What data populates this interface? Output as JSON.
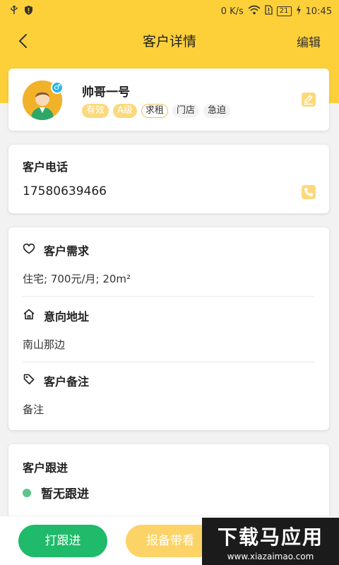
{
  "status_bar": {
    "network_speed": "0 K/s",
    "battery": "21",
    "time": "10:45"
  },
  "nav": {
    "title": "客户详情",
    "edit_label": "编辑",
    "back_icon": "chevron-left-icon"
  },
  "profile": {
    "name": "帅哥一号",
    "gender_symbol": "♂",
    "tags": [
      {
        "label": "有效",
        "style": "filled"
      },
      {
        "label": "A级",
        "style": "filled"
      },
      {
        "label": "求租",
        "style": "outline"
      },
      {
        "label": "门店",
        "style": "plain"
      },
      {
        "label": "急迫",
        "style": "plain"
      }
    ]
  },
  "phone": {
    "title": "客户电话",
    "number": "17580639466"
  },
  "needs": {
    "demand_label": "客户需求",
    "demand_value": "住宅; 700元/月; 20m²",
    "address_label": "意向地址",
    "address_value": "南山那边",
    "remark_label": "客户备注",
    "remark_value": "备注"
  },
  "follow": {
    "title": "客户跟进",
    "status": "暂无跟进"
  },
  "bottom": {
    "follow_button": "打跟进",
    "report_button": "报备带看"
  },
  "watermark": {
    "big": "下载马应用",
    "small": "www.xiazaimao.com"
  },
  "colors": {
    "brand_yellow": "#fdd03a",
    "green": "#1fba6a",
    "tag_yellow": "#fbd97c"
  }
}
